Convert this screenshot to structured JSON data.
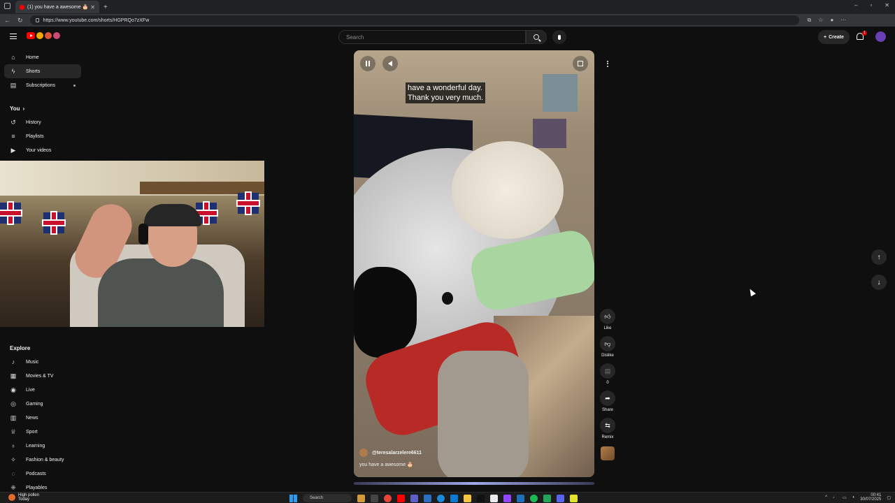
{
  "browser": {
    "tab_title": "(1) you have a awesome 🎂",
    "url": "https://www.youtube.com/shorts/HGPRQo7zXFw"
  },
  "header": {
    "search_placeholder": "Search",
    "create_label": "Create",
    "notification_count": "1"
  },
  "sidebar": {
    "items": [
      {
        "label": "Home",
        "icon": "home-icon"
      },
      {
        "label": "Shorts",
        "icon": "shorts-icon"
      },
      {
        "label": "Subscriptions",
        "icon": "subscriptions-icon"
      }
    ],
    "you_heading": "You",
    "you_items": [
      {
        "label": "History",
        "icon": "history-icon"
      },
      {
        "label": "Playlists",
        "icon": "playlists-icon"
      },
      {
        "label": "Your videos",
        "icon": "your-videos-icon"
      }
    ],
    "explore_heading": "Explore",
    "explore_items": [
      {
        "label": "Music",
        "icon": "music-icon"
      },
      {
        "label": "Movies & TV",
        "icon": "movies-icon"
      },
      {
        "label": "Live",
        "icon": "live-icon"
      },
      {
        "label": "Gaming",
        "icon": "gaming-icon"
      },
      {
        "label": "News",
        "icon": "news-icon"
      },
      {
        "label": "Sport",
        "icon": "trophy-icon"
      },
      {
        "label": "Learning",
        "icon": "learning-icon"
      },
      {
        "label": "Fashion & beauty",
        "icon": "fashion-icon"
      },
      {
        "label": "Podcasts",
        "icon": "podcast-icon"
      },
      {
        "label": "Playables",
        "icon": "playables-icon"
      }
    ]
  },
  "video": {
    "caption": "have a wonderful day.\nThank you very much.",
    "channel": "@teresalarzelere6611",
    "title": "you have a awesome 🎂"
  },
  "actions": {
    "like": "Like",
    "dislike": "Dislike",
    "comments": "0",
    "share": "Share",
    "remix": "Remix"
  },
  "taskbar": {
    "weather_title": "High pollen",
    "weather_sub": "Today",
    "search": "Search",
    "time": "00:41",
    "date": "30/07/2025"
  },
  "colors": {
    "background": "#0f0f0f",
    "brand_red": "#ff0000",
    "chip": "#272727"
  }
}
